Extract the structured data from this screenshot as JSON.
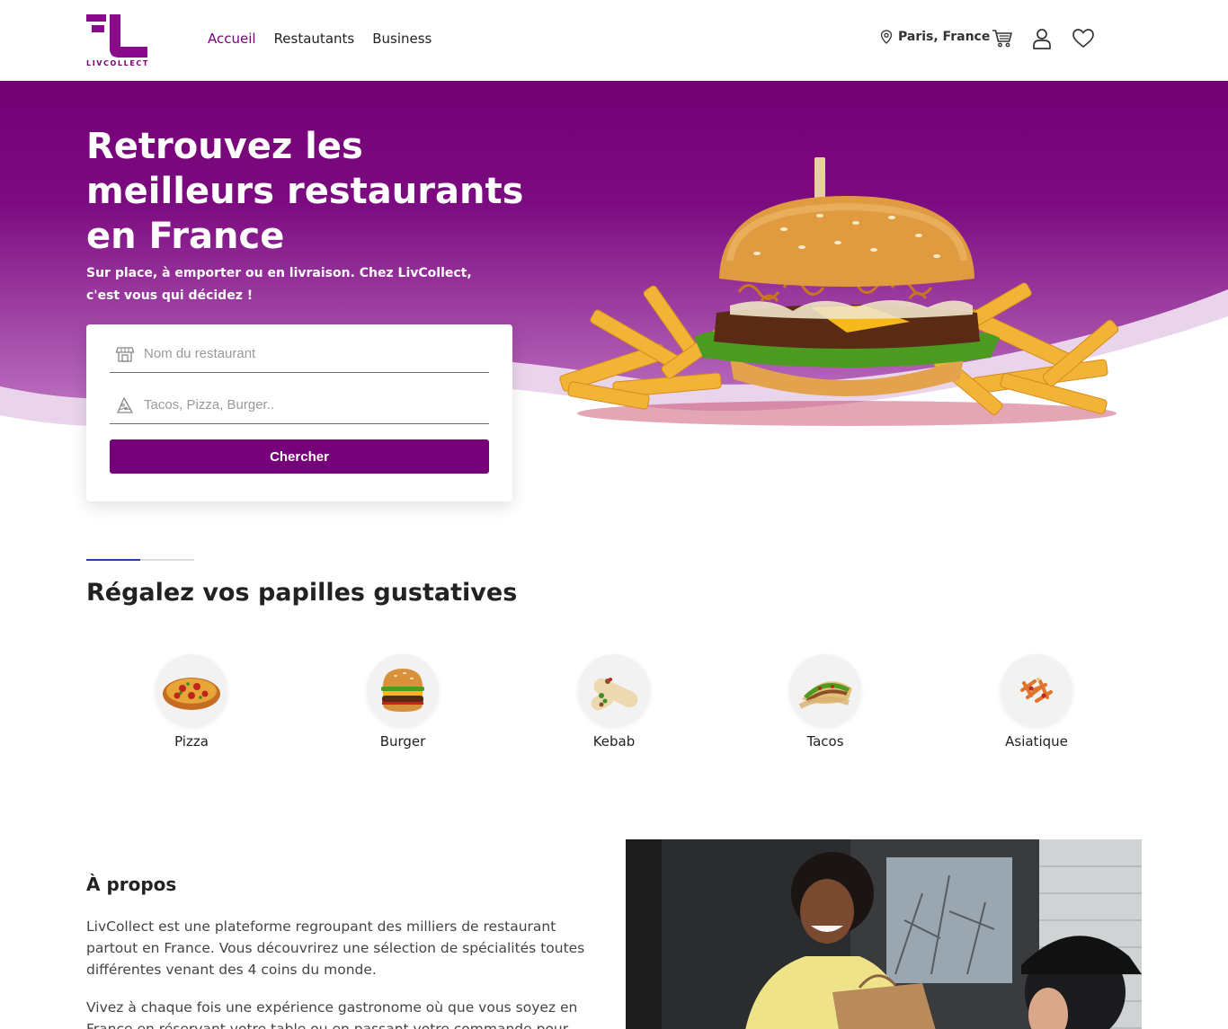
{
  "brand": {
    "name": "LIVCOLLECT",
    "primary_color": "#76007a",
    "accent_line_color": "#2b3bb0"
  },
  "nav": {
    "items": [
      {
        "label": "Accueil",
        "active": true
      },
      {
        "label": "Restautants",
        "active": false
      },
      {
        "label": "Business",
        "active": false
      }
    ]
  },
  "header": {
    "location": "Paris, France",
    "icons": [
      "map-pin-icon",
      "cart-icon",
      "user-icon",
      "heart-icon"
    ]
  },
  "hero": {
    "title": "Retrouvez les meilleurs restaurants en France",
    "subtitle": "Sur place, à emporter ou en livraison. Chez LivCollect, c'est vous qui décidez !",
    "image": "burger-with-fries"
  },
  "search": {
    "restaurant_placeholder": "Nom du restaurant",
    "cuisine_placeholder": "Tacos, Pizza, Burger..",
    "button_label": "Chercher"
  },
  "categories": {
    "title": "Régalez vos papilles gustatives",
    "items": [
      {
        "label": "Pizza",
        "icon": "pizza-icon"
      },
      {
        "label": "Burger",
        "icon": "burger-icon"
      },
      {
        "label": "Kebab",
        "icon": "kebab-icon"
      },
      {
        "label": "Tacos",
        "icon": "tacos-icon"
      },
      {
        "label": "Asiatique",
        "icon": "asian-food-icon"
      }
    ]
  },
  "about": {
    "title": "À propos",
    "paragraphs": [
      "LivCollect est une plateforme regroupant des milliers de restaurant partout en France. Vous découvrirez une sélection de spécialités toutes différentes venant des 4 coins du monde.",
      "Vivez à chaque fois une expérience gastronome où que vous soyez en France en réservant votre table ou en passant votre commande pour"
    ],
    "image": "delivery-handoff-photo"
  }
}
